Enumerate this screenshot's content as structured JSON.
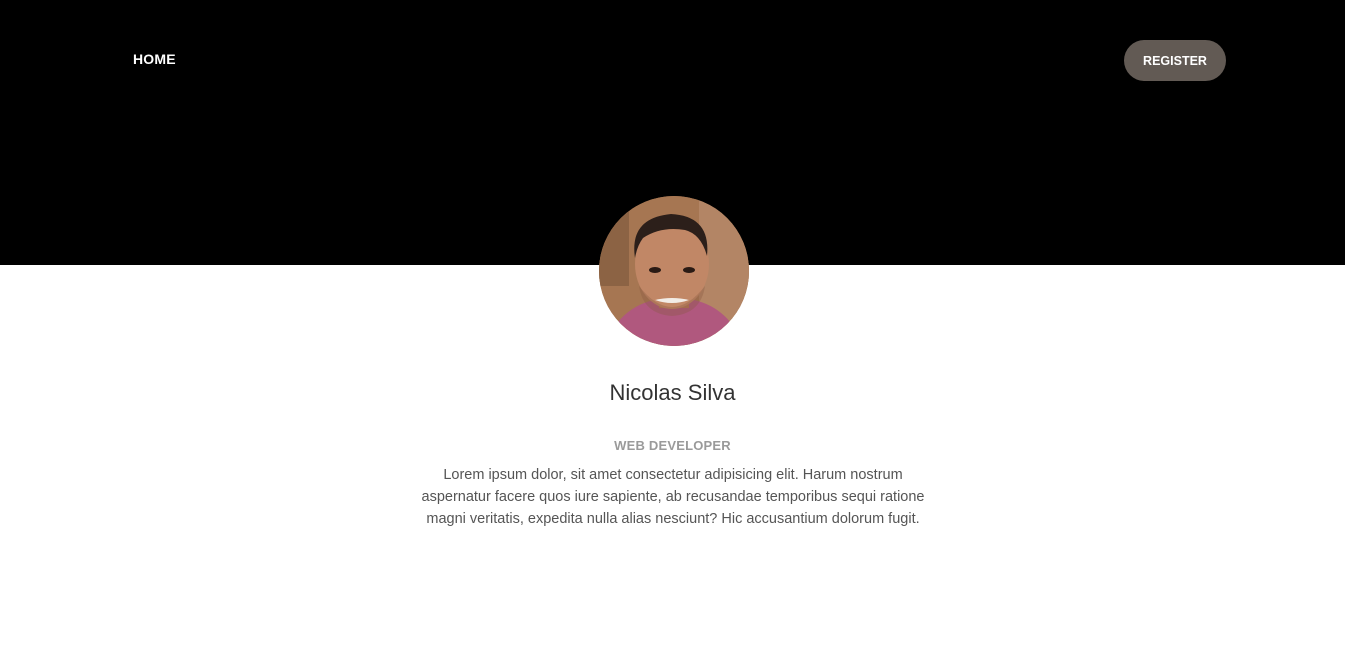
{
  "nav": {
    "home_label": "HOME",
    "register_label": "REGISTER"
  },
  "profile": {
    "name": "Nicolas Silva",
    "role": "WEB DEVELOPER",
    "bio": "Lorem ipsum dolor, sit amet consectetur adipisicing elit. Harum nostrum aspernatur facere quos iure sapiente, ab recusandae temporibus sequi ratione magni veritatis, expedita nulla alias nesciunt? Hic accusantium dolorum fugit."
  },
  "colors": {
    "header_bg": "#000000",
    "register_bg": "#625a54",
    "name_text": "#333333",
    "role_text": "#9a9a9a",
    "bio_text": "#555555"
  }
}
